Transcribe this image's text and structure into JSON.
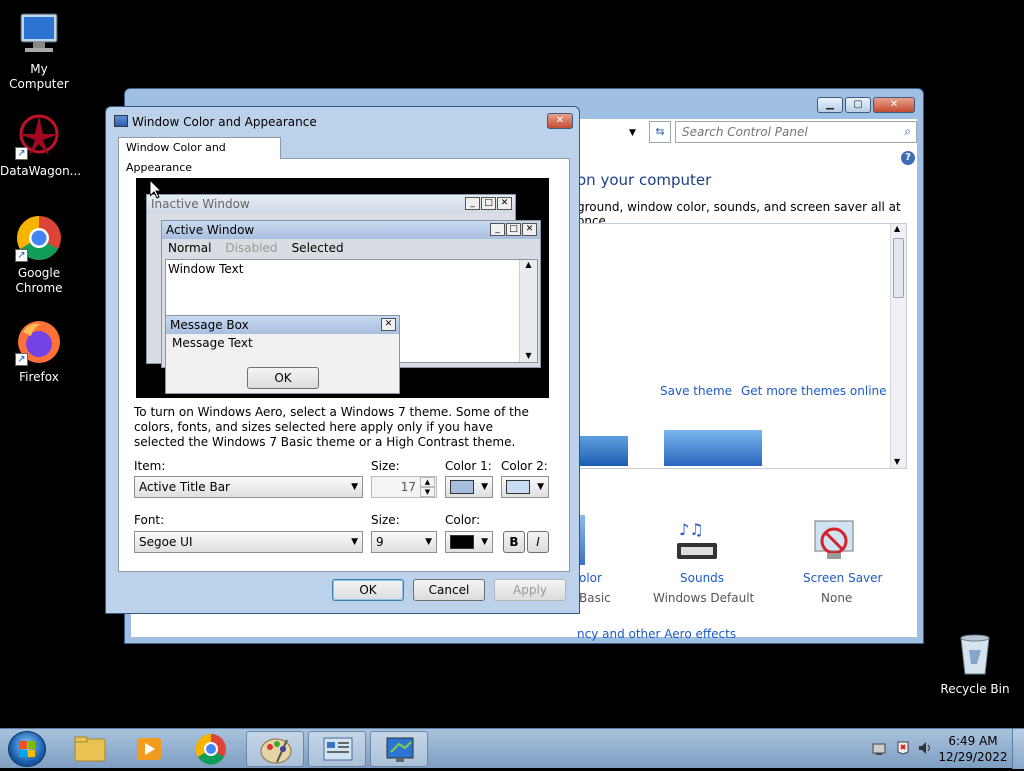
{
  "desktop": {
    "icons": [
      {
        "label": "My Computer"
      },
      {
        "label": "DataWagon..."
      },
      {
        "label": "Google Chrome"
      },
      {
        "label": "Firefox"
      },
      {
        "label": "Recycle Bin"
      }
    ]
  },
  "control_panel": {
    "search_placeholder": "Search Control Panel",
    "heading": "on your computer",
    "subheading": "ground, window color, sounds, and screen saver all at once.",
    "save_theme": "Save theme",
    "get_more_themes": "Get more themes online",
    "color_label": "olor",
    "color_sub": "Basic",
    "sounds_label": "Sounds",
    "sounds_sub": "Windows Default",
    "screensaver_label": "Screen Saver",
    "screensaver_sub": "None",
    "aero_link": "ncy and other Aero effects"
  },
  "dialog": {
    "title": "Window Color and Appearance",
    "tab": "Window Color and Appearance",
    "preview": {
      "inactive_title": "Inactive Window",
      "active_title": "Active Window",
      "menu_normal": "Normal",
      "menu_disabled": "Disabled",
      "menu_selected": "Selected",
      "window_text": "Window Text",
      "msgbox_title": "Message Box",
      "msgbox_text": "Message Text",
      "msgbox_ok": "OK"
    },
    "info_text": "To turn on Windows Aero, select a Windows 7 theme.  Some of the colors, fonts, and sizes selected here apply only if you have selected the Windows 7 Basic theme or a High Contrast theme.",
    "item_label": "Item:",
    "item_value": "Active Title Bar",
    "size_label": "Size:",
    "size_value": "17",
    "color1_label": "Color 1:",
    "color2_label": "Color 2:",
    "font_label": "Font:",
    "font_value": "Segoe UI",
    "font_size_label": "Size:",
    "font_size_value": "9",
    "font_color_label": "Color:",
    "bold_label": "B",
    "italic_label": "I",
    "ok_label": "OK",
    "cancel_label": "Cancel",
    "apply_label": "Apply",
    "colors": {
      "color1": "#a7bfdf",
      "color2": "#c7dcf2",
      "font_color": "#000000"
    }
  },
  "taskbar": {
    "time": "6:49 AM",
    "date": "12/29/2022"
  }
}
